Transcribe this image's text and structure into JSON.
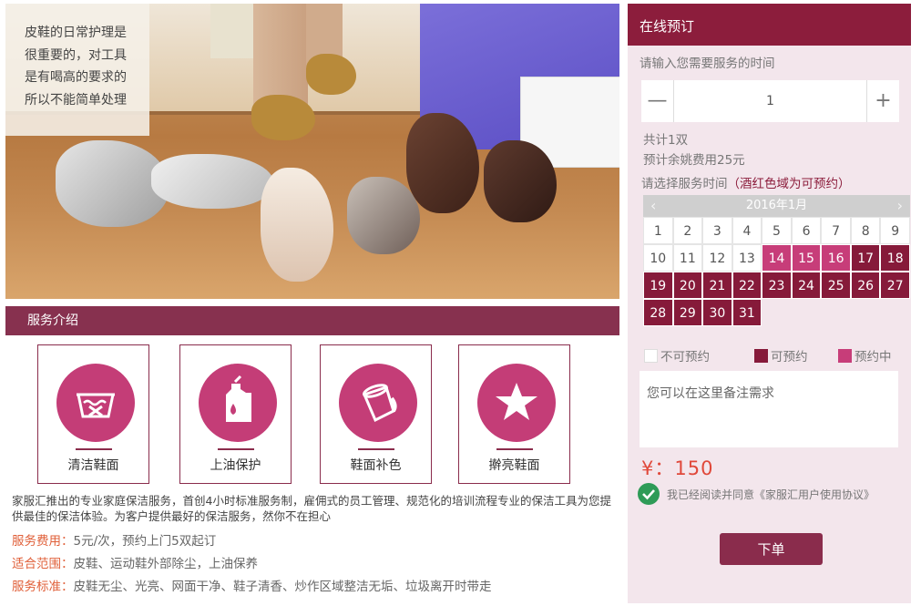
{
  "hero": {
    "caption_lines": [
      "皮鞋的日常护理是",
      "很重要的，对工具",
      "是有喝高的要求的",
      "所以不能简单处理"
    ]
  },
  "intro": {
    "title": "服务介绍",
    "services": [
      {
        "label": "清洁鞋面",
        "icon": "wash-basin-icon"
      },
      {
        "label": "上油保护",
        "icon": "oil-bottle-icon"
      },
      {
        "label": "鞋面补色",
        "icon": "paint-bucket-icon"
      },
      {
        "label": "擀亮鞋面",
        "icon": "star-icon"
      }
    ],
    "description": "家服汇推出的专业家庭保洁服务，首创4小时标准服务制，雇佣式的员工管理、规范化的培训流程专业的保洁工具为您提供最佳的保洁体验。为客户提供最好的保洁服务，然你不在担心",
    "fee_label": "服务费用：",
    "fee_value": "5元/次，预约上门5双起订",
    "scope_label": "适合范围：",
    "scope_value": "皮鞋、运动鞋外部除尘，上油保养",
    "standard_label": "服务标准：",
    "standard_value": "皮鞋无尘、光亮、网面干净、鞋子清香、炒作区域整洁无垢、垃圾离开时带走"
  },
  "booking": {
    "title": "在线预订",
    "time_prompt": "请输入您需要服务的时间",
    "quantity": "1",
    "minus_symbol": "—",
    "plus_symbol": "+",
    "total_text": "共计1双",
    "fee_text": "预计余姚费用25元",
    "choose_prefix": "请选择服务时间",
    "choose_hint": "（酒红色域为可预约）",
    "calendar": {
      "month_label": "2016年1月",
      "prev_symbol": "‹",
      "next_symbol": "›",
      "days": [
        {
          "d": "1",
          "s": "unavailable"
        },
        {
          "d": "2",
          "s": "unavailable"
        },
        {
          "d": "3",
          "s": "unavailable"
        },
        {
          "d": "4",
          "s": "unavailable"
        },
        {
          "d": "5",
          "s": "unavailable"
        },
        {
          "d": "6",
          "s": "unavailable"
        },
        {
          "d": "7",
          "s": "unavailable"
        },
        {
          "d": "8",
          "s": "unavailable"
        },
        {
          "d": "9",
          "s": "unavailable"
        },
        {
          "d": "10",
          "s": "unavailable"
        },
        {
          "d": "11",
          "s": "unavailable"
        },
        {
          "d": "12",
          "s": "unavailable"
        },
        {
          "d": "13",
          "s": "unavailable"
        },
        {
          "d": "14",
          "s": "booking"
        },
        {
          "d": "15",
          "s": "booking"
        },
        {
          "d": "16",
          "s": "booking"
        },
        {
          "d": "17",
          "s": "available"
        },
        {
          "d": "18",
          "s": "available"
        },
        {
          "d": "19",
          "s": "available"
        },
        {
          "d": "20",
          "s": "available"
        },
        {
          "d": "21",
          "s": "available"
        },
        {
          "d": "22",
          "s": "available"
        },
        {
          "d": "23",
          "s": "available"
        },
        {
          "d": "24",
          "s": "available"
        },
        {
          "d": "25",
          "s": "available"
        },
        {
          "d": "26",
          "s": "available"
        },
        {
          "d": "27",
          "s": "available"
        },
        {
          "d": "28",
          "s": "available"
        },
        {
          "d": "29",
          "s": "available"
        },
        {
          "d": "30",
          "s": "available"
        },
        {
          "d": "31",
          "s": "available"
        }
      ]
    },
    "legend": {
      "unavailable": "不可预约",
      "available": "可预约",
      "booking": "预约中"
    },
    "notes_placeholder": "您可以在这里备注需求",
    "price": "¥：150",
    "agreement_text": "我已经阅读并同意《家服汇用户使用协议》",
    "order_button": "下单"
  },
  "colors": {
    "brand": "#8c1d3c",
    "available": "#861a3a",
    "booking": "#c73d79",
    "price": "#e0483a",
    "label_orange": "#e0603a"
  }
}
